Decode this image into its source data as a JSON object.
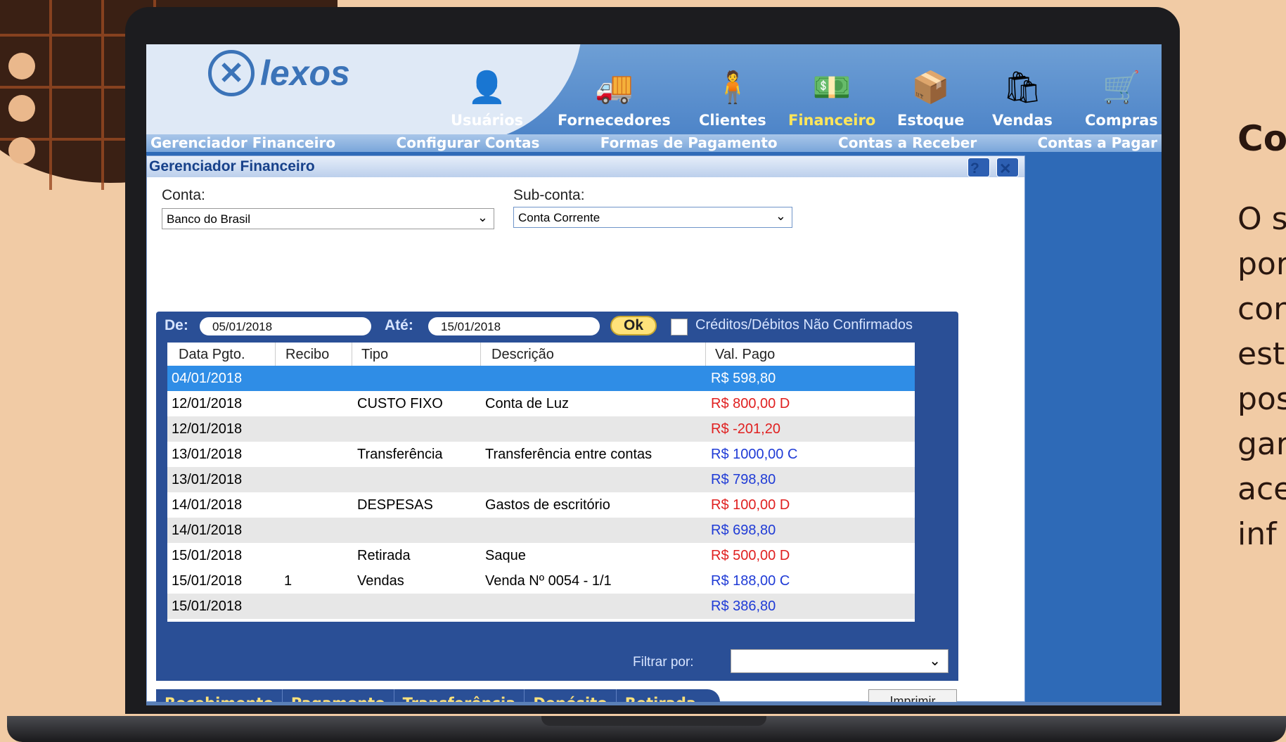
{
  "side": {
    "title": "Co",
    "lines": [
      "O s",
      "por",
      "con",
      "est",
      "pos",
      "gar",
      "ace",
      "inf"
    ]
  },
  "app": {
    "logo": "lexos"
  },
  "nav": [
    {
      "label": "Usuários",
      "icon": "user-icon"
    },
    {
      "label": "Fornecedores",
      "icon": "truck-icon"
    },
    {
      "label": "Clientes",
      "icon": "client-icon"
    },
    {
      "label": "Financeiro",
      "icon": "money-icon",
      "active": true
    },
    {
      "label": "Estoque",
      "icon": "box-icon"
    },
    {
      "label": "Vendas",
      "icon": "register-icon"
    },
    {
      "label": "Compras",
      "icon": "cart-icon"
    }
  ],
  "subnav": [
    "Gerenciador Financeiro",
    "Configurar Contas",
    "Formas de Pagamento",
    "Contas a Receber",
    "Contas a Pagar"
  ],
  "window": {
    "title": "Gerenciador Financeiro",
    "help": "?",
    "close": "✕",
    "conta_label": "Conta:",
    "conta_value": "Banco do Brasil",
    "subconta_label": "Sub-conta:",
    "subconta_value": "Conta Corrente"
  },
  "filter": {
    "de_label": "De:",
    "de_value": "05/01/2018",
    "ate_label": "Até:",
    "ate_value": "15/01/2018",
    "ok_label": "Ok",
    "unconfirmed_label": "Créditos/Débitos Não Confirmados",
    "filtrar_label": "Filtrar por:"
  },
  "table": {
    "headers": [
      "Data Pgto.",
      "Recibo",
      "Tipo",
      "Descrição",
      "Val. Pago"
    ],
    "rows": [
      {
        "data": "04/01/2018",
        "recibo": "",
        "tipo": "",
        "descricao": "",
        "valor": "R$ 598,80",
        "color": "blue",
        "selected": true
      },
      {
        "data": "12/01/2018",
        "recibo": "",
        "tipo": "CUSTO FIXO",
        "descricao": "Conta de Luz",
        "valor": "R$ 800,00 D",
        "color": "red"
      },
      {
        "data": "12/01/2018",
        "recibo": "",
        "tipo": "",
        "descricao": "",
        "valor": "R$ -201,20",
        "color": "red"
      },
      {
        "data": "13/01/2018",
        "recibo": "",
        "tipo": "Transferência",
        "descricao": "Transferência entre contas",
        "valor": "R$ 1000,00 C",
        "color": "blue"
      },
      {
        "data": "13/01/2018",
        "recibo": "",
        "tipo": "",
        "descricao": "",
        "valor": "R$ 798,80",
        "color": "blue"
      },
      {
        "data": "14/01/2018",
        "recibo": "",
        "tipo": "DESPESAS",
        "descricao": "Gastos de escritório",
        "valor": "R$ 100,00 D",
        "color": "red"
      },
      {
        "data": "14/01/2018",
        "recibo": "",
        "tipo": "",
        "descricao": "",
        "valor": "R$ 698,80",
        "color": "blue"
      },
      {
        "data": "15/01/2018",
        "recibo": "",
        "tipo": "Retirada",
        "descricao": "Saque",
        "valor": "R$ 500,00 D",
        "color": "red"
      },
      {
        "data": "15/01/2018",
        "recibo": "1",
        "tipo": "Vendas",
        "descricao": "Venda Nº 0054 - 1/1",
        "valor": "R$ 188,00 C",
        "color": "blue"
      },
      {
        "data": "15/01/2018",
        "recibo": "",
        "tipo": "",
        "descricao": "",
        "valor": "R$ 386,80",
        "color": "blue"
      }
    ]
  },
  "actions": [
    "Recebimento",
    "Pagamento",
    "Transferência",
    "Depósito",
    "Retirada"
  ],
  "print_label": "Imprimir"
}
